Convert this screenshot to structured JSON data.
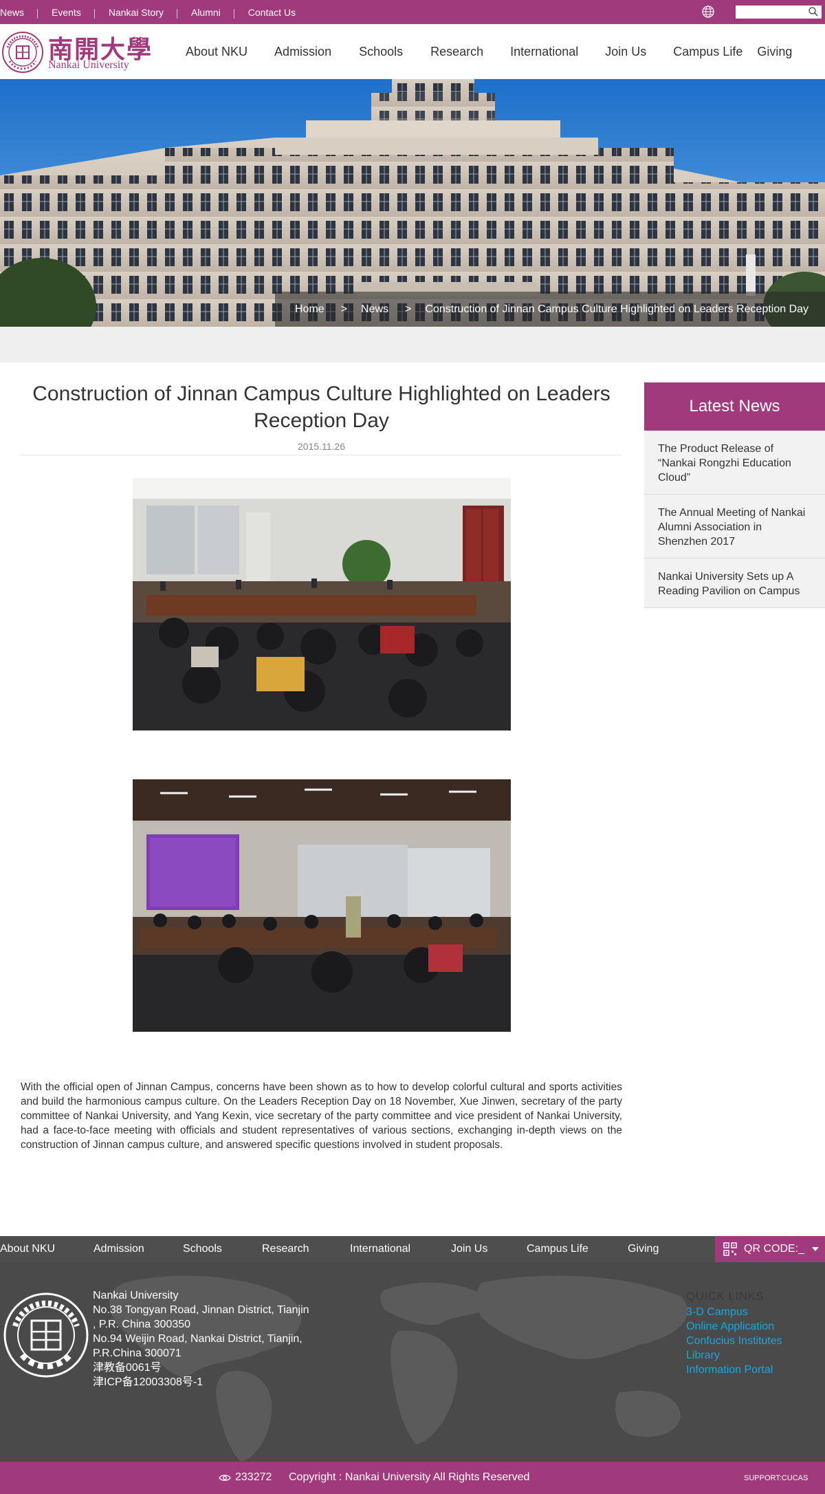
{
  "topbar": {
    "links": [
      "News",
      "Events",
      "Nankai Story",
      "Alumni",
      "Contact Us"
    ],
    "search_placeholder": ""
  },
  "header": {
    "logo_cn": "南開大學",
    "logo_en": "Nankai University",
    "nav": [
      "About NKU",
      "Admission",
      "Schools",
      "Research",
      "International",
      "Join Us",
      "Campus Life",
      "Giving"
    ]
  },
  "breadcrumb": {
    "items": [
      "Home",
      "News"
    ],
    "separator": ">",
    "current": "Construction of Jinnan Campus Culture Highlighted on Leaders Reception Day"
  },
  "article": {
    "title": "Construction of Jinnan Campus Culture Highlighted on Leaders Reception Day",
    "date": "2015.11.26",
    "body": "With the official open of Jinnan Campus, concerns have been shown as to how to develop colorful cultural and sports activities and build the harmonious campus culture. On the Leaders Reception Day on 18 November, Xue Jinwen, secretary of the party committee of Nankai University, and Yang Kexin, vice secretary of the party committee and vice president of Nankai University, had a face-to-face meeting with officials and student representatives of various sections, exchanging in-depth views on the construction of Jinnan campus culture, and answered specific questions involved in student proposals."
  },
  "sidebar": {
    "title": "Latest News",
    "items": [
      "The Product Release of “Nankai Rongzhi Education Cloud”",
      "The Annual Meeting of Nankai Alumni Association in Shenzhen 2017",
      "Nankai University Sets up A Reading Pavilion on Campus"
    ]
  },
  "footer": {
    "nav": [
      "About NKU",
      "Admission",
      "Schools",
      "Research",
      "International",
      "Join Us",
      "Campus Life",
      "Giving"
    ],
    "qr_label": "QR CODE:_",
    "address_lines": [
      "Nankai University",
      "No.38 Tongyan Road, Jinnan District, Tianjin",
      ", P.R. China 300350",
      "No.94 Weijin Road,  Nankai District, Tianjin,",
      "P.R.China  300071",
      "津教备0061号",
      "津ICP备12003308号-1"
    ],
    "quick_links_title": "QUICK LINKS",
    "quick_links": [
      "3-D Campus",
      "Online Application",
      "Confucius Institutes",
      "Library",
      "Information Portal"
    ],
    "visits": "233272",
    "copyright": "Copyright : Nankai University All Rights Reserved",
    "support": "SUPPORT:CUCAS"
  },
  "colors": {
    "brand": "#a13a7d",
    "footer_bg": "#4a4a4a",
    "link": "#1aa6e0"
  }
}
